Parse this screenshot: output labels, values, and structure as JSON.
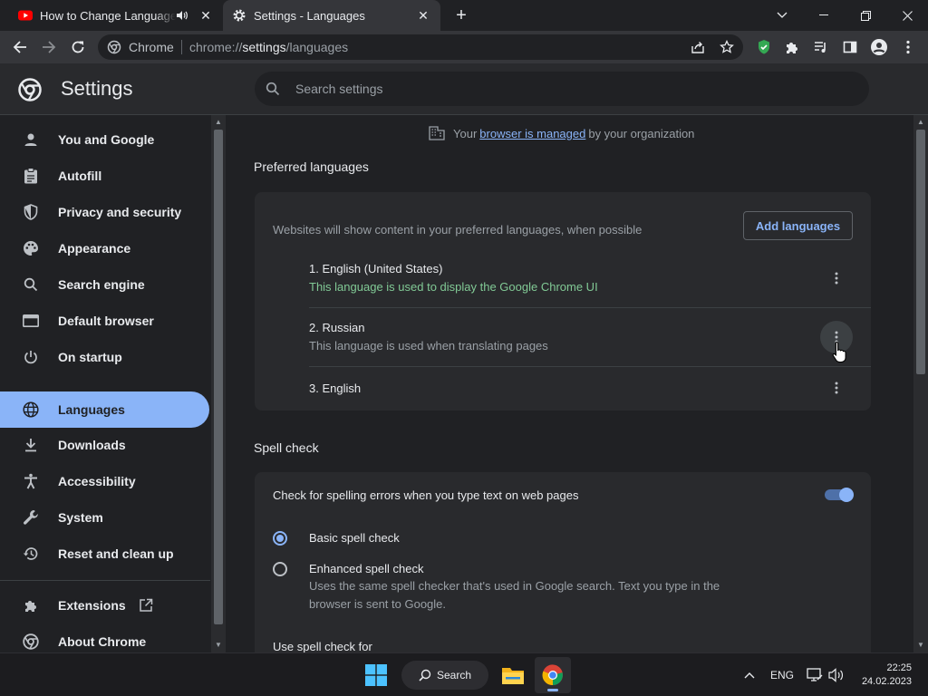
{
  "browser": {
    "tabs": [
      {
        "title": "How to Change Language Se",
        "active": false,
        "icon": "youtube-icon",
        "audio": true
      },
      {
        "title": "Settings - Languages",
        "active": true,
        "icon": "gear-icon"
      }
    ],
    "omnibox": {
      "site": "Chrome",
      "url_prefix": "chrome://",
      "url_host": "settings",
      "url_path": "/languages"
    }
  },
  "settings": {
    "title": "Settings",
    "search_placeholder": "Search settings",
    "nav": [
      {
        "label": "You and Google",
        "icon": "person-icon"
      },
      {
        "label": "Autofill",
        "icon": "clipboard-icon"
      },
      {
        "label": "Privacy and security",
        "icon": "shield-icon"
      },
      {
        "label": "Appearance",
        "icon": "palette-icon"
      },
      {
        "label": "Search engine",
        "icon": "search-icon"
      },
      {
        "label": "Default browser",
        "icon": "browser-icon"
      },
      {
        "label": "On startup",
        "icon": "power-icon"
      },
      {
        "label": "Languages",
        "icon": "globe-icon",
        "active": true
      },
      {
        "label": "Downloads",
        "icon": "download-icon"
      },
      {
        "label": "Accessibility",
        "icon": "accessibility-icon"
      },
      {
        "label": "System",
        "icon": "wrench-icon"
      },
      {
        "label": "Reset and clean up",
        "icon": "history-icon"
      },
      {
        "label": "Extensions",
        "icon": "puzzle-icon"
      },
      {
        "label": "About Chrome",
        "icon": "chrome-icon"
      }
    ],
    "managed": {
      "prefix": "Your",
      "link": "browser is managed",
      "suffix": "by your organization"
    },
    "preferred": {
      "title": "Preferred languages",
      "note": "Websites will show content in your preferred languages, when possible",
      "add_button": "Add languages",
      "languages": [
        {
          "name": "1. English (United States)",
          "note": "This language is used to display the Google Chrome UI",
          "note_color": "#81c995"
        },
        {
          "name": "2. Russian",
          "note": "This language is used when translating pages",
          "note_color": "#9aa0a6"
        },
        {
          "name": "3. English",
          "note": ""
        }
      ]
    },
    "spell": {
      "title": "Spell check",
      "toggle_label": "Check for spelling errors when you type text on web pages",
      "toggle_on": true,
      "options": [
        {
          "label": "Basic spell check",
          "selected": true,
          "desc": ""
        },
        {
          "label": "Enhanced spell check",
          "selected": false,
          "desc": "Uses the same spell checker that's used in Google search. Text you type in the browser is sent to Google."
        }
      ],
      "use_for": "Use spell check for"
    }
  },
  "taskbar": {
    "search_label": "Search",
    "lang": "ENG",
    "time": "22:25",
    "date": "24.02.2023"
  },
  "colors": {
    "accent": "#8ab4f8",
    "background": "#202124",
    "surface": "#292a2d"
  }
}
